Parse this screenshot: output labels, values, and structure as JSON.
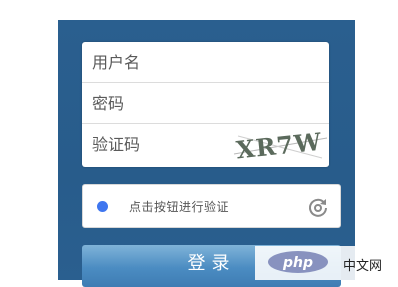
{
  "form": {
    "username_placeholder": "用户名",
    "password_placeholder": "密码",
    "captcha_placeholder": "验证码",
    "captcha_text": "XR7W"
  },
  "verify": {
    "label": "点击按钮进行验证"
  },
  "login": {
    "label": "登录"
  },
  "watermark": {
    "logo_text": "php",
    "site_text": "中文网"
  },
  "colors": {
    "panel": "#285c8b",
    "verify_dot": "#3f76ef",
    "button": "#4b8cc2"
  }
}
